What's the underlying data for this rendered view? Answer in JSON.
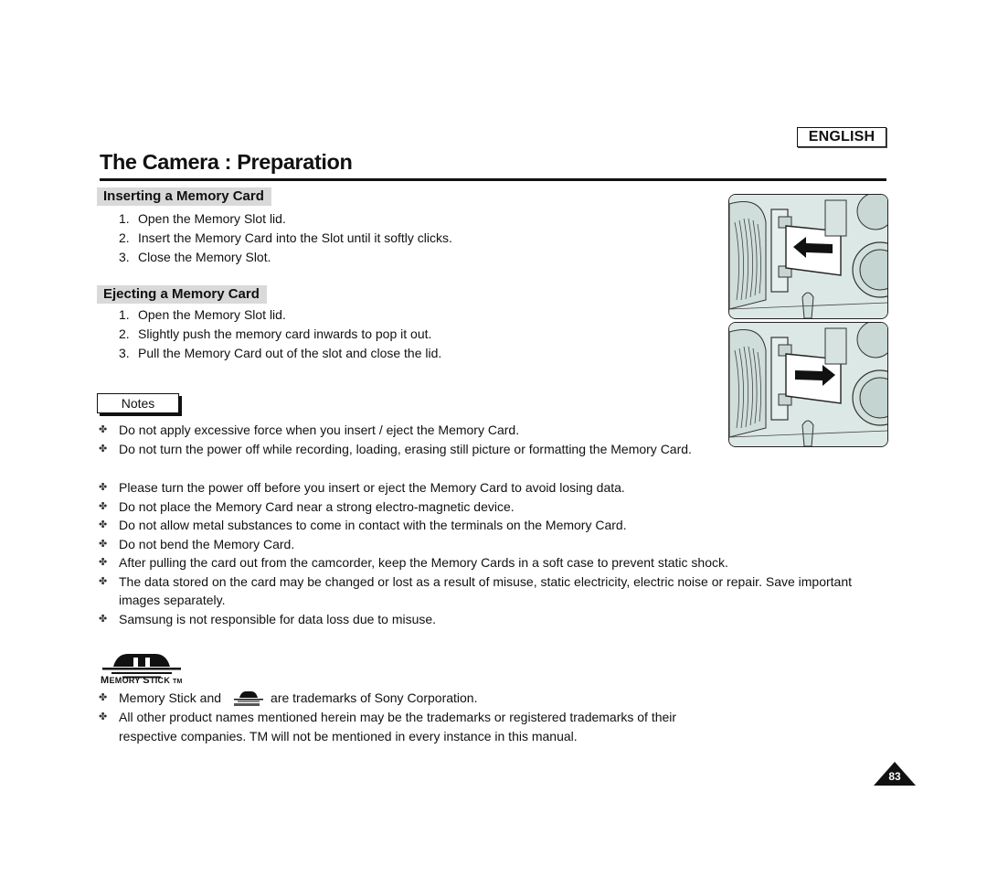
{
  "header": {
    "language": "ENGLISH",
    "title": "The Camera : Preparation"
  },
  "sections": [
    {
      "heading": "Inserting a Memory Card",
      "steps": [
        {
          "num": "1.",
          "text": "Open the Memory Slot lid."
        },
        {
          "num": "2.",
          "text": "Insert the Memory Card into the Slot until it softly clicks."
        },
        {
          "num": "3.",
          "text": "Close the Memory Slot."
        }
      ]
    },
    {
      "heading": "Ejecting a Memory Card",
      "steps": [
        {
          "num": "1.",
          "text": "Open the Memory Slot lid."
        },
        {
          "num": "2.",
          "text": "Slightly push the memory card inwards to pop it out."
        },
        {
          "num": "3.",
          "text": "Pull the Memory Card out of the slot and close the lid."
        }
      ]
    }
  ],
  "illustrations": [
    {
      "icon": "card-insert-arrow-left-icon",
      "description": "Memory card being inserted into camera slot"
    },
    {
      "icon": "card-eject-arrow-right-icon",
      "description": "Memory card being ejected from camera slot"
    }
  ],
  "notes": {
    "label": "Notes",
    "bullet_glyph": "✤",
    "items": [
      "Do not apply excessive force when you insert / eject the Memory Card.",
      "Do not turn the power off while recording, loading, erasing still picture or formatting the Memory Card.",
      "Please turn the power off before you insert or eject the Memory Card to avoid losing data.",
      "Do not place the Memory Card near a strong electro-magnetic device.",
      "Do not allow metal substances to come in contact with the terminals on the Memory Card.",
      "Do not bend the Memory Card.",
      "After pulling the card out from the camcorder, keep the Memory Cards in a soft case to prevent static shock.",
      "The data stored on the card may be changed or lost as a result of misuse, static electricity, electric noise or repair. Save important images separately.",
      "Samsung is not responsible for data loss due to misuse."
    ]
  },
  "trademark": {
    "logo_text_first": "M",
    "logo_text_first_rest": "EMORY",
    "logo_text_second": "S",
    "logo_text_second_rest": "TICK",
    "logo_tm": "TM",
    "items": [
      {
        "before": "Memory Stick and",
        "after": "are trademarks of Sony Corporation."
      },
      {
        "text": "All other product names mentioned herein may be the trademarks or registered trademarks of their respective companies.  TM  will not be mentioned in every instance in this manual."
      }
    ]
  },
  "footer": {
    "page_number": "83"
  }
}
